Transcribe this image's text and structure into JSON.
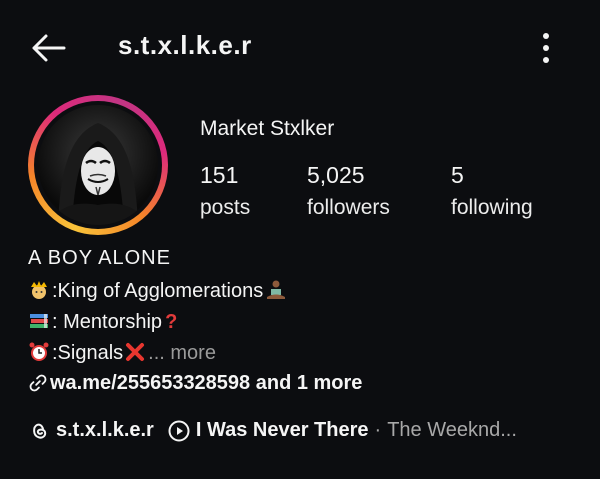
{
  "header": {
    "username": "s.t.x.l.k.e.r"
  },
  "profile": {
    "display_name": "Market Stxlker",
    "stats": [
      {
        "value": "151",
        "label": "posts"
      },
      {
        "value": "5,025",
        "label": "followers"
      },
      {
        "value": "5",
        "label": "following"
      }
    ]
  },
  "bio": {
    "headline": "A BOY ALONE",
    "line1": ":King of Agglomerations",
    "line2": ": Mentorship",
    "line3": ":Signals",
    "more": "... more",
    "link": "wa.me/255653328598 and 1 more"
  },
  "footer": {
    "threads_handle": "s.t.x.l.k.e.r",
    "song": "I Was Never There",
    "separator": "·",
    "artist": "The Weeknd..."
  },
  "icons": {
    "back": "arrow-left-icon",
    "menu": "more-vertical-icon",
    "crown": "crown-emoji",
    "meditation": "meditation-emoji",
    "books": "books-emoji",
    "question": "question-mark-emoji",
    "alarm": "alarm-clock-emoji",
    "cross": "cross-mark-emoji",
    "link": "link-icon",
    "threads": "threads-icon",
    "play": "play-icon"
  },
  "colors": {
    "background": "#0c0d10",
    "text": "#f5f5f5",
    "muted": "#a8a8a8"
  }
}
